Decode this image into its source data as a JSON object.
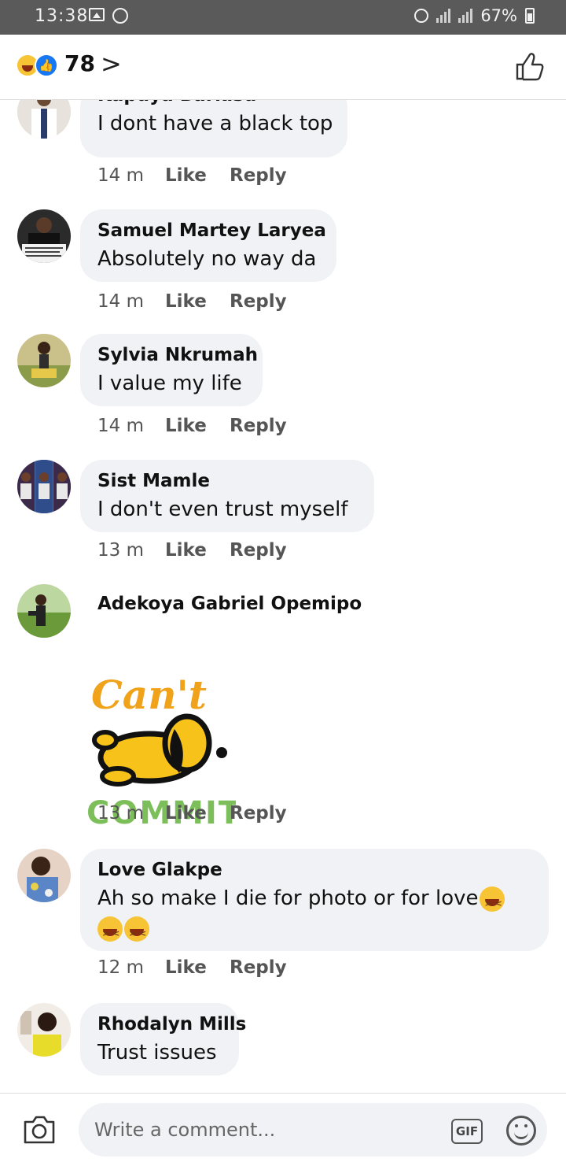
{
  "status_bar": {
    "time": "13:38",
    "battery": "67%"
  },
  "reactions": {
    "count": "78",
    "chevron": ">"
  },
  "comments": [
    {
      "name": "Kapuya Barkisu",
      "text": "I dont have a black top",
      "time": "14 m",
      "like": "Like",
      "reply": "Reply"
    },
    {
      "name": "Samuel Martey Laryea",
      "text": "Absolutely no way da",
      "time": "14 m",
      "like": "Like",
      "reply": "Reply"
    },
    {
      "name": "Sylvia Nkrumah",
      "text": "I value my life",
      "time": "14 m",
      "like": "Like",
      "reply": "Reply"
    },
    {
      "name": "Sist Mamle",
      "text": "I don't even trust myself",
      "time": "13 m",
      "like": "Like",
      "reply": "Reply"
    },
    {
      "name": "Adekoya Gabriel Opemipo",
      "sticker_top": "Can't",
      "sticker_bottom": "COMMIT",
      "time": "13 m",
      "like": "Like",
      "reply": "Reply"
    },
    {
      "name": "Love Glakpe",
      "text": "Ah so make I die for photo or for love",
      "time": "12 m",
      "like": "Like",
      "reply": "Reply"
    },
    {
      "name": "Rhodalyn Mills",
      "text": "Trust issues"
    }
  ],
  "composer": {
    "placeholder": "Write a comment...",
    "gif_label": "GIF"
  }
}
